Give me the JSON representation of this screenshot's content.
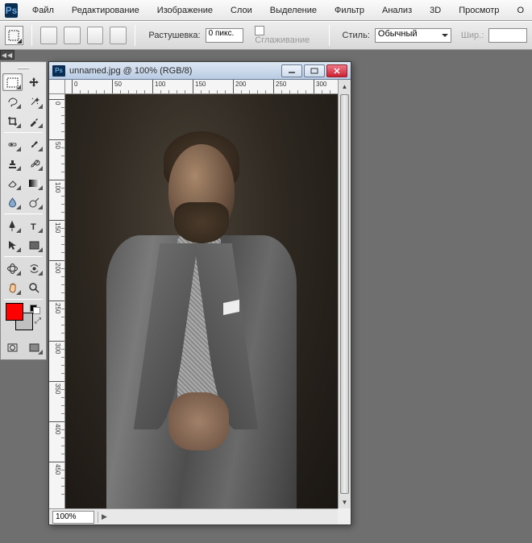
{
  "app_logo": "Ps",
  "menu": [
    "Файл",
    "Редактирование",
    "Изображение",
    "Слои",
    "Выделение",
    "Фильтр",
    "Анализ",
    "3D",
    "Просмотр",
    "О"
  ],
  "options": {
    "feather_label": "Растушевка:",
    "feather_value": "0 пикс.",
    "antialias_label": "Сглаживание",
    "style_label": "Стиль:",
    "style_value": "Обычный",
    "width_label": "Шир.:"
  },
  "collapse_glyph": "◀◀",
  "document": {
    "title": "unnamed.jpg @ 100% (RGB/8)",
    "zoom": "100%",
    "ruler_ticks": [
      "0",
      "50",
      "100",
      "150",
      "200",
      "250",
      "300"
    ],
    "ruler_ticks_v": [
      "0",
      "50",
      "100",
      "150",
      "200",
      "250",
      "300",
      "350",
      "400",
      "450"
    ]
  },
  "colors": {
    "foreground": "#ff0000",
    "background": "#c0c0c0"
  }
}
